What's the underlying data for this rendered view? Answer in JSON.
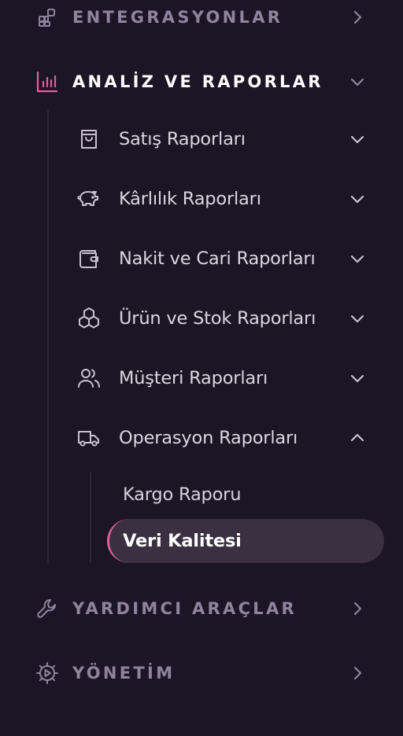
{
  "colors": {
    "background": "#1c1526",
    "accent": "#e0609a",
    "active_bg": "#3a3042",
    "muted_text": "#8f849c",
    "icon": "#c9c1d2"
  },
  "sections": [
    {
      "label": "ENTEGRASYONLAR",
      "icon": "blocks-icon",
      "state": "collapsed"
    },
    {
      "label": "ANALİZ VE RAPORLAR",
      "icon": "bar-chart-icon",
      "state": "expanded"
    },
    {
      "label": "YARDIMCI ARAÇLAR",
      "icon": "wrench-icon",
      "state": "collapsed"
    },
    {
      "label": "YÖNETİM",
      "icon": "gear-icon",
      "state": "collapsed"
    }
  ],
  "reports": [
    {
      "label": "Satış Raporları",
      "icon": "shopping-bag-icon",
      "state": "collapsed"
    },
    {
      "label": "Kârlılık Raporları",
      "icon": "piggy-bank-icon",
      "state": "collapsed"
    },
    {
      "label": "Nakit ve Cari Raporları",
      "icon": "wallet-icon",
      "state": "collapsed"
    },
    {
      "label": "Ürün ve Stok Raporları",
      "icon": "boxes-icon",
      "state": "collapsed"
    },
    {
      "label": "Müşteri Raporları",
      "icon": "users-icon",
      "state": "collapsed"
    },
    {
      "label": "Operasyon Raporları",
      "icon": "truck-icon",
      "state": "expanded"
    }
  ],
  "operation_reports": [
    {
      "label": "Kargo Raporu",
      "active": false
    },
    {
      "label": "Veri Kalitesi",
      "active": true
    }
  ]
}
